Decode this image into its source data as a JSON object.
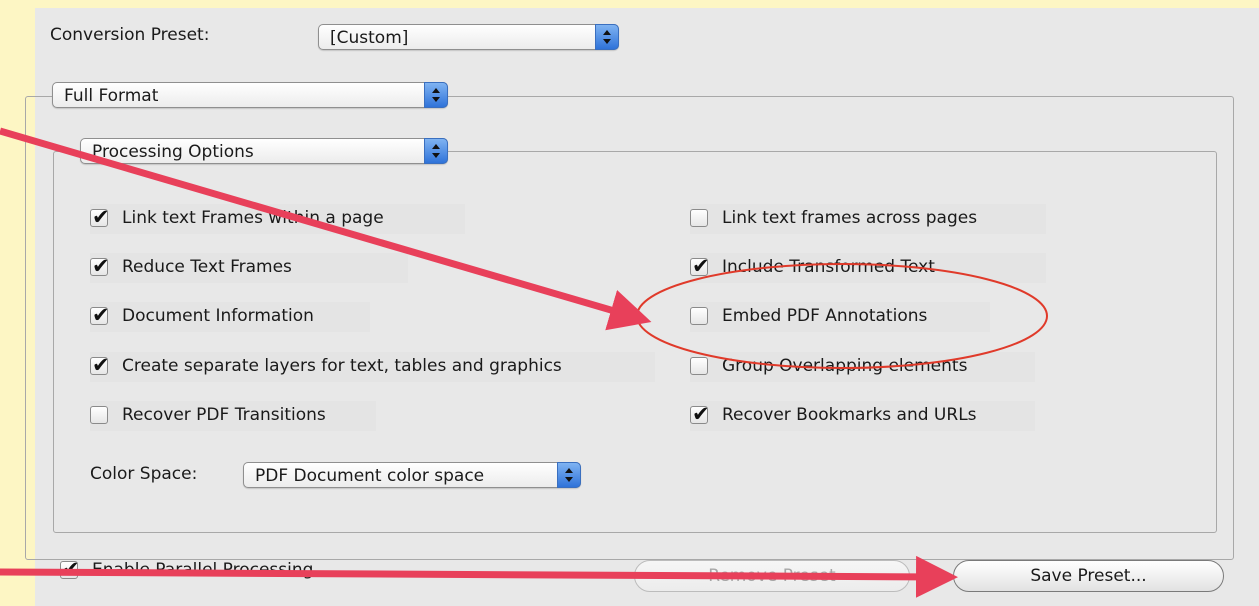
{
  "conversion_preset": {
    "label": "Conversion Preset:",
    "value": "[Custom]"
  },
  "format_popup": {
    "value": "Full Format"
  },
  "options_popup": {
    "value": "Processing Options"
  },
  "options": [
    {
      "label": "Link text Frames within a page",
      "checked": true
    },
    {
      "label": "Reduce Text Frames",
      "checked": true
    },
    {
      "label": "Document Information",
      "checked": true
    },
    {
      "label": "Create separate layers for text, tables and graphics",
      "checked": true
    },
    {
      "label": "Recover PDF Transitions",
      "checked": false
    },
    {
      "label": "Link text frames across pages",
      "checked": false
    },
    {
      "label": "Include Transformed Text",
      "checked": true
    },
    {
      "label": "Embed PDF Annotations",
      "checked": false
    },
    {
      "label": "Group Overlapping elements",
      "checked": false
    },
    {
      "label": "Recover Bookmarks and URLs",
      "checked": true
    }
  ],
  "color_space": {
    "label": "Color Space:",
    "value": "PDF Document color space"
  },
  "parallel": {
    "label": "Enable Parallel Processing",
    "checked": true
  },
  "buttons": {
    "remove": "Remove Preset",
    "save": "Save Preset..."
  },
  "colors": {
    "annotation_arrow": "#e8405a",
    "highlight_ellipse": "#e03a2a",
    "popup_arrows": "#2f73d9",
    "background": "#fdf6c4"
  }
}
